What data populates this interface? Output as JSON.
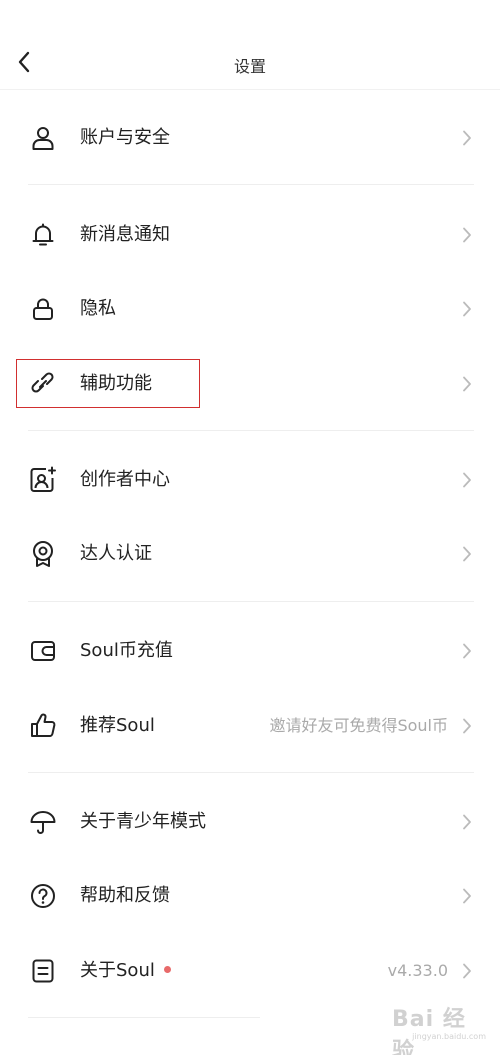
{
  "header": {
    "title": "设置"
  },
  "rows": [
    {
      "label": "账户与安全",
      "icon": "person-icon"
    },
    {
      "label": "新消息通知",
      "icon": "bell-icon"
    },
    {
      "label": "隐私",
      "icon": "lock-icon"
    },
    {
      "label": "辅助功能",
      "icon": "link-icon"
    },
    {
      "label": "创作者中心",
      "icon": "creator-portrait-icon"
    },
    {
      "label": "达人认证",
      "icon": "badge-icon"
    },
    {
      "label": "Soul币充值",
      "icon": "wallet-icon"
    },
    {
      "label": "推荐Soul",
      "icon": "thumbs-up-icon",
      "value": "邀请好友可免费得Soul币"
    },
    {
      "label": "关于青少年模式",
      "icon": "umbrella-icon"
    },
    {
      "label": "帮助和反馈",
      "icon": "question-circle-icon"
    },
    {
      "label": "关于Soul",
      "icon": "document-icon",
      "value": "v4.33.0"
    }
  ],
  "watermark": {
    "text": "Bai 经验",
    "sub": "jingyan.baidu.com"
  },
  "colors": {
    "highlight": "#d12f2f",
    "red_dot": "#e86a6a",
    "secondary_text": "#aaaaaa"
  }
}
